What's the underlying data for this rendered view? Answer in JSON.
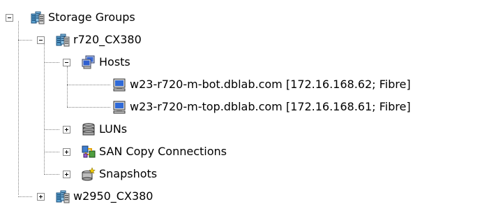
{
  "tree": {
    "root": {
      "label": "Storage Groups",
      "icon": "storage-group-icon",
      "state": "expanded"
    },
    "groups": [
      {
        "label": "r720_CX380",
        "icon": "storage-group-icon",
        "state": "expanded",
        "children": [
          {
            "label": "Hosts",
            "icon": "hosts-icon",
            "state": "expanded",
            "children": [
              {
                "label": "w23-r720-m-bot.dblab.com [172.16.168.62; Fibre]",
                "icon": "host-computer-icon"
              },
              {
                "label": "w23-r720-m-top.dblab.com [172.16.168.61; Fibre]",
                "icon": "host-computer-icon"
              }
            ]
          },
          {
            "label": "LUNs",
            "icon": "luns-icon",
            "state": "collapsed"
          },
          {
            "label": "SAN Copy Connections",
            "icon": "san-copy-icon",
            "state": "collapsed"
          },
          {
            "label": "Snapshots",
            "icon": "snapshots-icon",
            "state": "collapsed"
          }
        ]
      },
      {
        "label": "w2950_CX380",
        "icon": "storage-group-icon",
        "state": "collapsed"
      }
    ]
  }
}
